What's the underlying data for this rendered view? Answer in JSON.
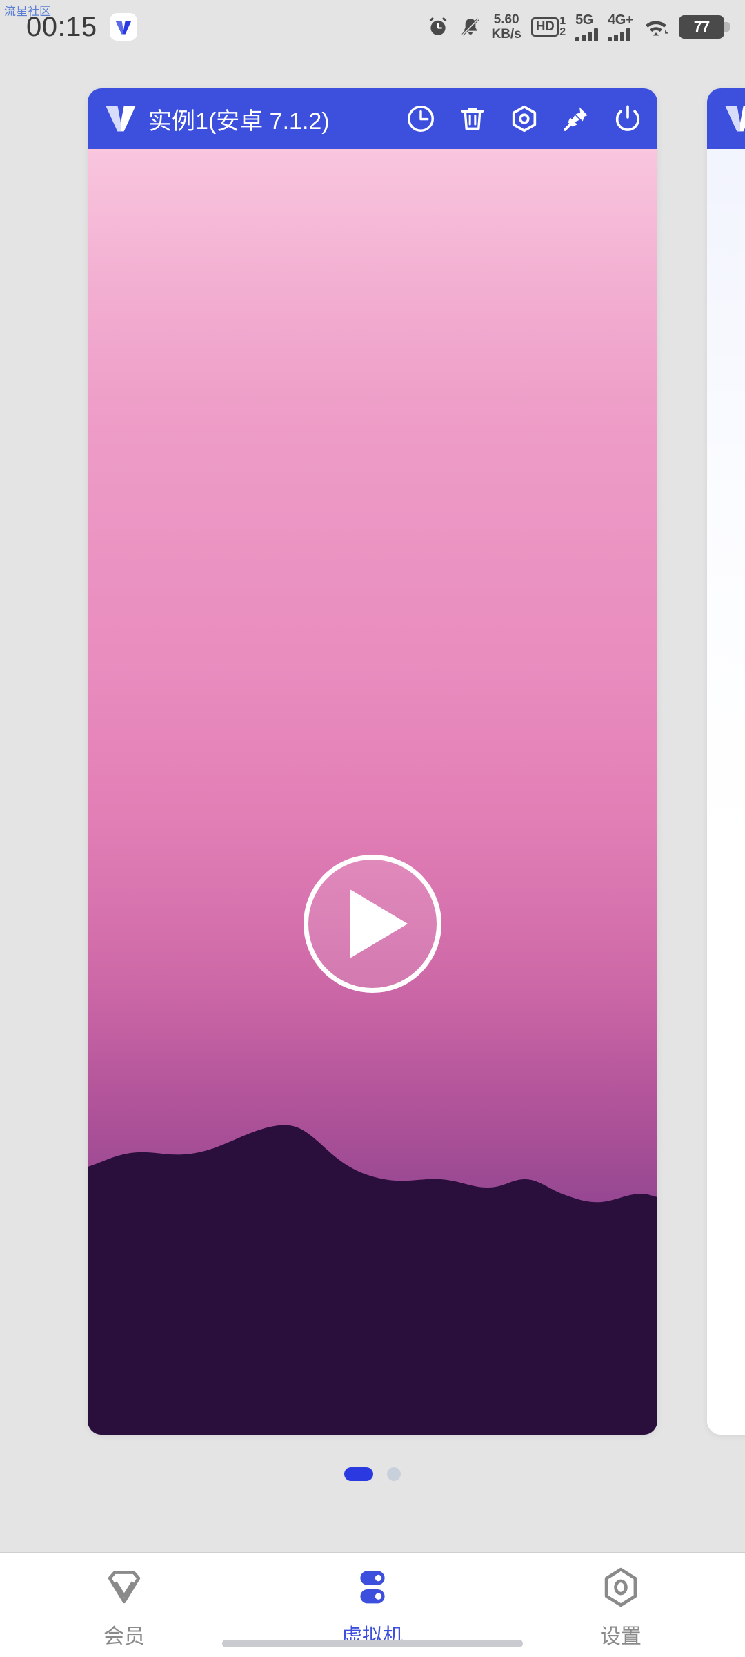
{
  "watermark": "流星社区",
  "statusbar": {
    "clock": "00:15",
    "app_icon": "vmos-v-icon",
    "alarm_icon": "alarm-clock-icon",
    "mute_icon": "bell-muted-icon",
    "net_speed_value": "5.60",
    "net_speed_unit": "KB/s",
    "hd_label": "HD",
    "hd_sim_top": "1",
    "hd_sim_bottom": "2",
    "sim1_network": "5G",
    "sim2_network": "4G+",
    "wifi_icon": "wifi-icon",
    "battery_level": "77"
  },
  "carousel": {
    "cards": [
      {
        "logo_icon": "vmos-v-icon",
        "title": "实例1(安卓 7.1.2)",
        "actions": [
          {
            "name": "history-clock-icon",
            "label": "备份"
          },
          {
            "name": "trash-icon",
            "label": "删除"
          },
          {
            "name": "hexagon-settings-icon",
            "label": "设置"
          },
          {
            "name": "pin-icon",
            "label": "置顶"
          },
          {
            "name": "power-icon",
            "label": "电源"
          }
        ],
        "play_button_label": "启动",
        "wallpaper_top_color": "#f9c6de",
        "wallpaper_mid_color": "#e98cbe",
        "wallpaper_bottom_color": "#4a2c7e",
        "mountain_color": "#2a0f3d"
      },
      {
        "logo_icon": "vmos-v-icon",
        "title": "",
        "actions": [],
        "play_button_label": ""
      }
    ],
    "page_dots": [
      {
        "active": true
      },
      {
        "active": false
      }
    ]
  },
  "bottomnav": {
    "items": [
      {
        "icon": "member-diamond-icon",
        "label": "会员",
        "active": false
      },
      {
        "icon": "virtual-machine-icon",
        "label": "虚拟机",
        "active": true
      },
      {
        "icon": "settings-hexagon-icon",
        "label": "设置",
        "active": false
      }
    ]
  },
  "colors": {
    "accent": "#3d50dd",
    "accent_dot": "#2a3ae0",
    "page_background": "#e4e4e4",
    "nav_inactive": "#8a8a8a",
    "status_icon": "#4a4a4a"
  }
}
